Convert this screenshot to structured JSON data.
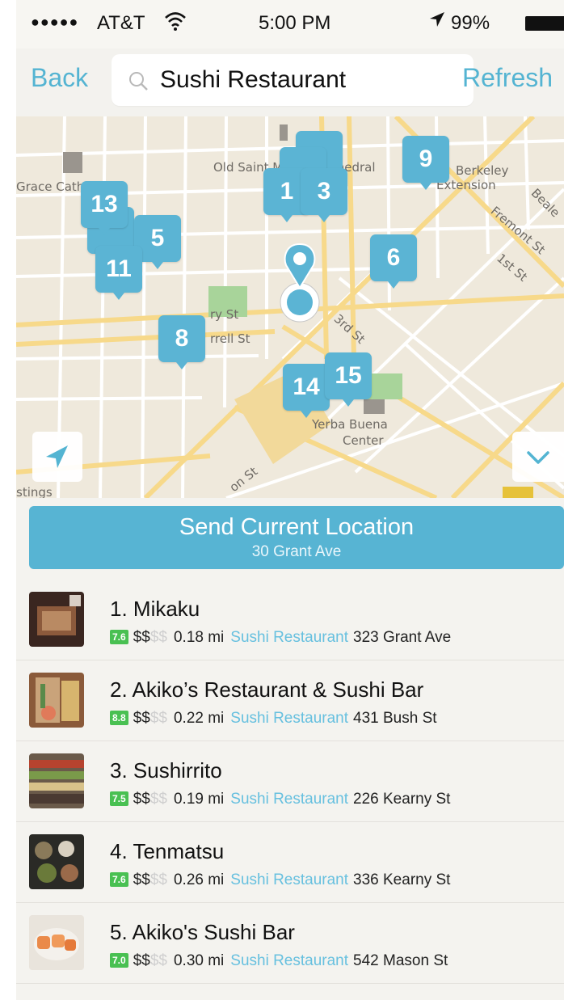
{
  "status_bar": {
    "signal": "●●●●●",
    "carrier": "AT&T",
    "time": "5:00 PM",
    "battery": "99%"
  },
  "nav": {
    "back_label": "Back",
    "refresh_label": "Refresh",
    "search_value": "Sushi Restaurant"
  },
  "map": {
    "labels": {
      "grace": "Grace Cathedral",
      "old_saint": "Old Saint Mary's Cathedral",
      "berkeley1": "Berkeley",
      "berkeley2": "Extension",
      "beale": "Beale",
      "fremont": "Fremont St",
      "first": "1st St",
      "third": "3rd St",
      "sutter": "ry St",
      "farrell": "rrell St",
      "yerba1": "Yerba Buena",
      "yerba2": "Center",
      "listings": "stings",
      "mission": "on St"
    },
    "pins": [
      "1",
      "3",
      "5",
      "6",
      "8",
      "9",
      "11",
      "13",
      "14",
      "15"
    ],
    "pin_color": "#5bb4d4",
    "current_location_icon": "map-marker-icon"
  },
  "send_location": {
    "title": "Send Current Location",
    "address": "30 Grant Ave"
  },
  "results": [
    {
      "name": "1. Mikaku",
      "rating": "7.6",
      "price": "$$",
      "price_rest": "$$",
      "distance": "0.18 mi",
      "category": "Sushi Restaurant",
      "address": "323 Grant Ave"
    },
    {
      "name": "2. Akiko’s Restaurant & Sushi Bar",
      "rating": "8.8",
      "price": "$$",
      "price_rest": "$$",
      "distance": "0.22 mi",
      "category": "Sushi Restaurant",
      "address": "431 Bush St"
    },
    {
      "name": "3. Sushirrito",
      "rating": "7.5",
      "price": "$$",
      "price_rest": "$$",
      "distance": "0.19 mi",
      "category": "Sushi Restaurant",
      "address": "226 Kearny St"
    },
    {
      "name": "4. Tenmatsu",
      "rating": "7.6",
      "price": "$$",
      "price_rest": "$$",
      "distance": "0.26 mi",
      "category": "Sushi Restaurant",
      "address": "336 Kearny St"
    },
    {
      "name": "5. Akiko's Sushi Bar",
      "rating": "7.0",
      "price": "$$",
      "price_rest": "$$",
      "distance": "0.30 mi",
      "category": "Sushi Restaurant",
      "address": "542 Mason St"
    }
  ],
  "colors": {
    "accent": "#54b4d2",
    "rating_green": "#49c052",
    "category_link": "#67c0df"
  }
}
